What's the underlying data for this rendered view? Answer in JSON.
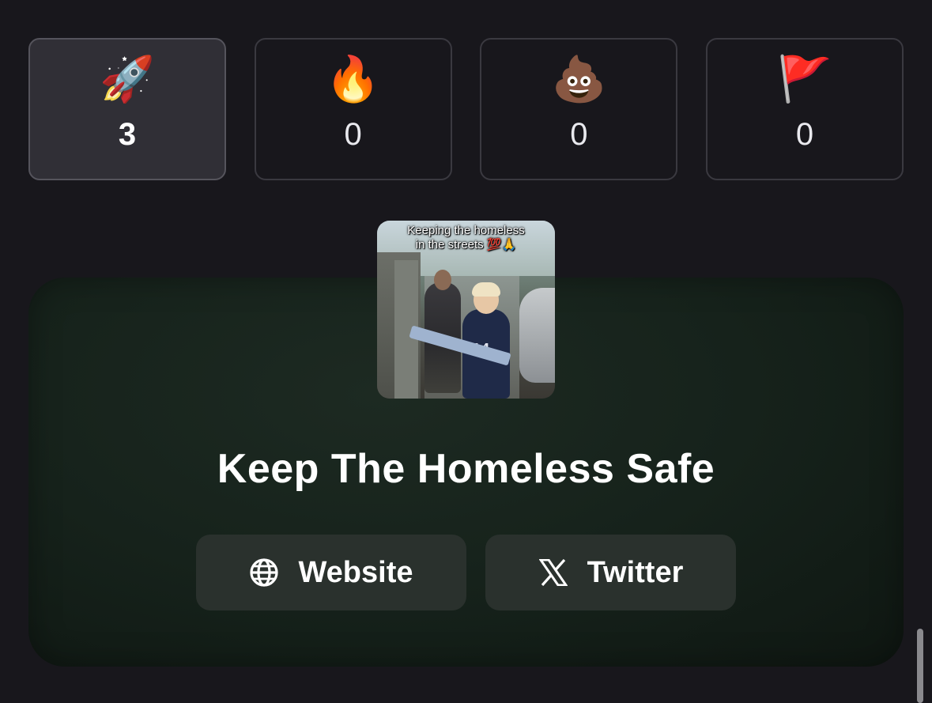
{
  "reactions": [
    {
      "icon": "rocket-icon",
      "emoji": "🚀",
      "count": "3",
      "active": true
    },
    {
      "icon": "fire-icon",
      "emoji": "🔥",
      "count": "0",
      "active": false
    },
    {
      "icon": "poop-icon",
      "emoji": "💩",
      "count": "0",
      "active": false
    },
    {
      "icon": "red-flag-icon",
      "emoji": "🚩",
      "count": "0",
      "active": false
    }
  ],
  "token": {
    "image_caption_line1": "Keeping the homeless",
    "image_caption_line2": "in the streets 💯🙏",
    "title": "Keep The Homeless Safe"
  },
  "links": {
    "website": {
      "icon": "globe-icon",
      "label": "Website"
    },
    "twitter": {
      "icon": "x-logo-icon",
      "label": "Twitter"
    }
  },
  "colors": {
    "background": "#18171c",
    "card_background": "#16221b",
    "button_background": "#2a312d",
    "active_reaction_background": "#302f36"
  }
}
